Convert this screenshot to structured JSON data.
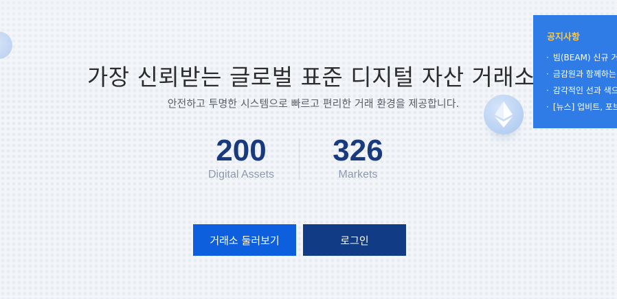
{
  "hero": {
    "title": "가장 신뢰받는 글로벌 표준 디지털 자산 거래소",
    "subtitle": "안전하고 투명한 시스템으로 빠르고 편리한 거래 환경을 제공합니다."
  },
  "stats": [
    {
      "value": "200",
      "label": "Digital Assets"
    },
    {
      "value": "326",
      "label": "Markets"
    }
  ],
  "buttons": {
    "explore": "거래소 둘러보기",
    "login": "로그인"
  },
  "notice": {
    "title": "공지사항",
    "bullet": "·",
    "items": [
      "빔(BEAM) 신규 거",
      "금감원과 함께하는",
      "감각적인 선과 색으",
      "[뉴스] 업비트, 포브"
    ]
  },
  "icons": {
    "coin_left": "coin-icon",
    "coin_right": "ethereum-icon"
  },
  "colors": {
    "primary_button": "#0d5fde",
    "secondary_button": "#123b86",
    "stat_number": "#1a3a7e",
    "notice_bg": "#2f7ce6",
    "notice_title": "#ffc93c"
  }
}
